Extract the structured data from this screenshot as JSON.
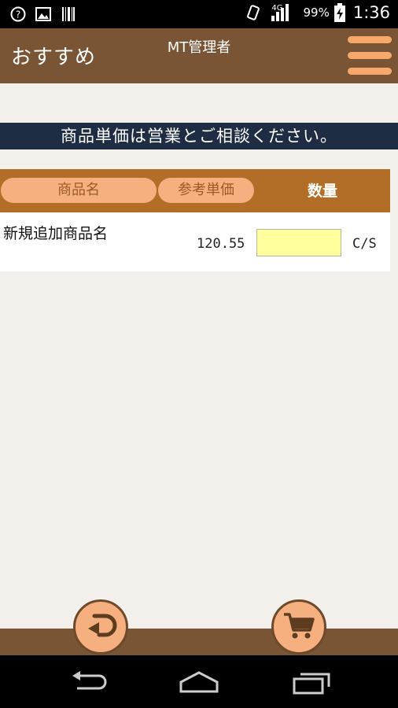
{
  "status_bar": {
    "icons_left": [
      "help-icon",
      "image-icon",
      "barcode-icon"
    ],
    "network_label": "4G",
    "battery": "99%",
    "time": "1:36"
  },
  "header": {
    "title": "おすすめ",
    "subtitle": "MT管理者",
    "menu_icon": "hamburger-menu-icon"
  },
  "notice": "商品単価は営業とご相談ください。",
  "table": {
    "col_name": "商品名",
    "col_price": "参考単価",
    "col_qty": "数量",
    "rows": [
      {
        "name": "新規追加商品名",
        "price": "120.55",
        "qty": "",
        "unit": "C/S"
      }
    ]
  },
  "footer": {
    "back_icon": "back-arrow-icon",
    "cart_icon": "shopping-cart-icon"
  },
  "colors": {
    "header_brown": "#7a5535",
    "notice_navy": "#1e2d44",
    "table_header": "#b26e26",
    "pill_orange": "#f6b07f",
    "input_yellow": "#ffff9e"
  }
}
